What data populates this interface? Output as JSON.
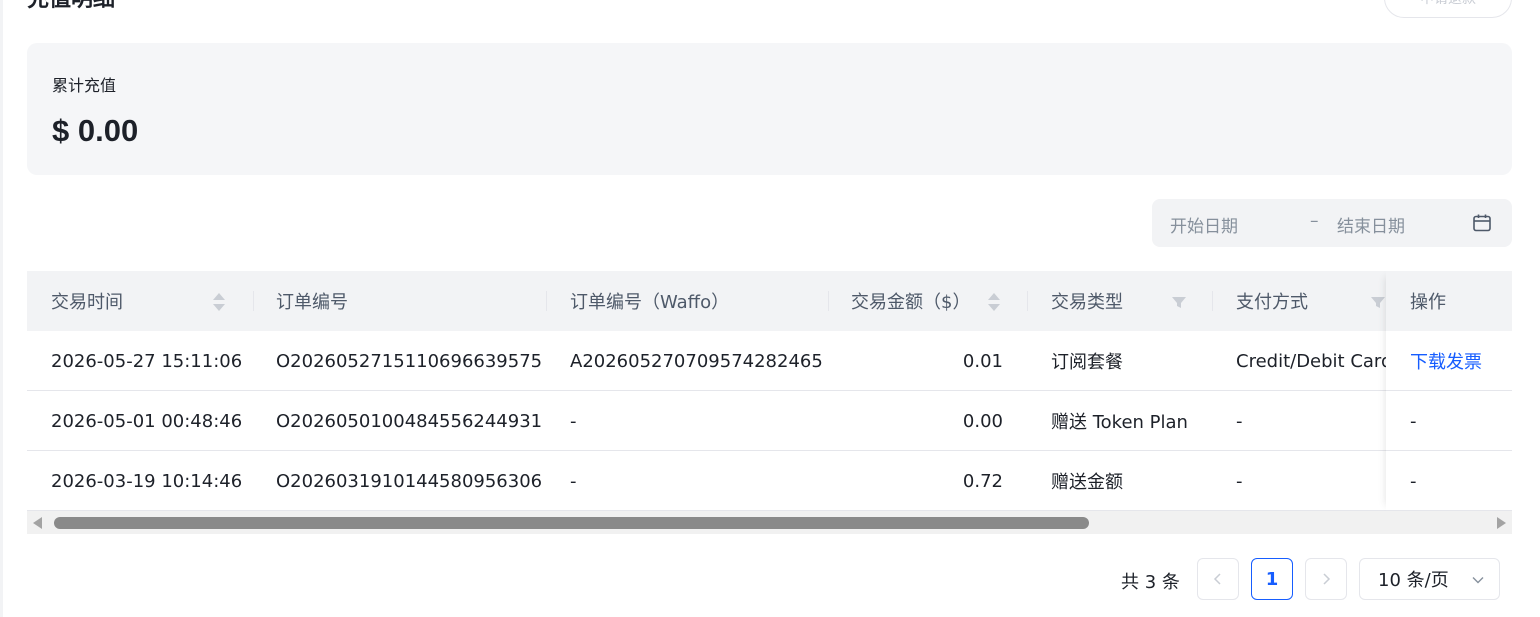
{
  "header": {
    "title": "充值明细",
    "action_label": "申请退款"
  },
  "summary": {
    "label": "累计充值",
    "value": "$ 0.00"
  },
  "date_range": {
    "start_placeholder": "开始日期",
    "separator": "–",
    "end_placeholder": "结束日期"
  },
  "table": {
    "columns": [
      "交易时间",
      "订单编号",
      "订单编号（Waffo）",
      "交易金额（$）",
      "交易类型",
      "支付方式",
      "操作"
    ],
    "rows": [
      {
        "time": "2026-05-27 15:11:06",
        "order_id": "O202605271511 0696639575",
        "waffo_id": "A20260527070957428 2465",
        "amount": "0.01",
        "type": "订阅套餐",
        "payment": "Credit/Debit Card",
        "action": "下载发票"
      },
      {
        "time": "2026-05-01 00:48:46",
        "order_id": "O202605010048 4556244931",
        "waffo_id": "-",
        "amount": "0.00",
        "type": "赠送 Token Plan",
        "payment": "-",
        "action": "-"
      },
      {
        "time": "2026-03-19 10:14:46",
        "order_id": "O202603191014 4580956306",
        "waffo_id": "-",
        "amount": "0.72",
        "type": "赠送金额",
        "payment": "-",
        "action": "-"
      }
    ]
  },
  "pagination": {
    "total": "共 3 条",
    "current_page": "1",
    "page_size": "10 条/页"
  },
  "colors": {
    "accent": "#165dff",
    "header_bg": "#f2f3f5",
    "summary_bg": "#f5f6f8"
  }
}
